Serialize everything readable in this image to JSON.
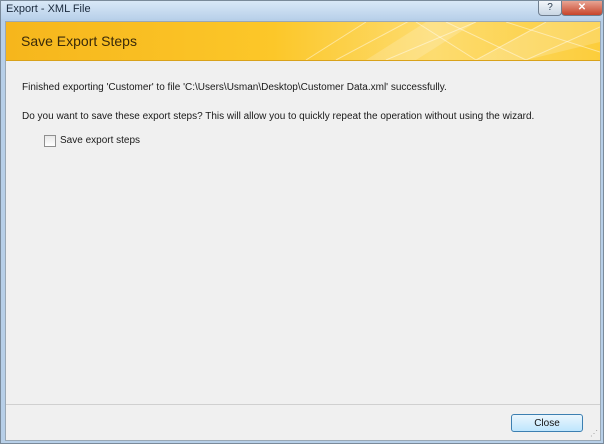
{
  "window": {
    "title": "Export - XML File",
    "help_glyph": "?",
    "close_glyph": "✕"
  },
  "banner": {
    "title": "Save Export Steps"
  },
  "content": {
    "result_message": "Finished exporting 'Customer' to file 'C:\\Users\\Usman\\Desktop\\Customer Data.xml' successfully.",
    "prompt": "Do you want to save these export steps? This will allow you to quickly repeat the operation without using the wizard.",
    "save_steps_checkbox": {
      "label": "Save export steps",
      "checked": false
    }
  },
  "footer": {
    "close_label": "Close"
  },
  "colors": {
    "banner_gold": "#fcc729",
    "titlebar_blue": "#b9d1ea",
    "close_red": "#c7442b",
    "dialog_bg": "#f0f0f0"
  }
}
